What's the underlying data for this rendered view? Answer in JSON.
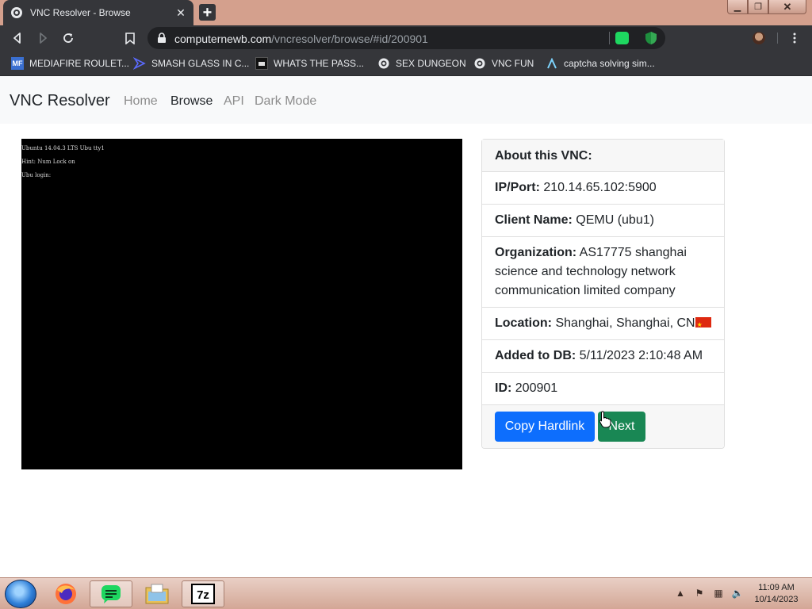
{
  "browser": {
    "tab_title": "VNC Resolver - Browse",
    "tab_close": "✕",
    "url_host": "computernewb.com",
    "url_path": "/vncresolver/browse/#id/200901"
  },
  "bookmarks": [
    {
      "icon_text": "MF",
      "label": "MEDIAFIRE ROULET..."
    },
    {
      "icon_text": "",
      "label": "SMASH GLASS IN C..."
    },
    {
      "icon_text": "",
      "label": "WHATS THE PASS..."
    },
    {
      "icon_text": "",
      "label": "SEX DUNGEON"
    },
    {
      "icon_text": "",
      "label": "VNC FUN"
    },
    {
      "icon_text": "",
      "label": "captcha solving sim..."
    }
  ],
  "navbar": {
    "brand": "VNC Resolver",
    "links": [
      "Home",
      "Browse",
      "API",
      "Dark Mode"
    ],
    "active": "Browse"
  },
  "vnc_screen": {
    "lines": [
      "Ubuntu 14.04.3 LTS Ubu tty1",
      "Hint: Num Lock on",
      "Ubu login:"
    ]
  },
  "details": {
    "header": "About this VNC:",
    "ip_label": "IP/Port:",
    "ip_value": "210.14.65.102:5900",
    "client_label": "Client Name:",
    "client_value": "QEMU (ubu1)",
    "org_label": "Organization:",
    "org_value": "AS17775 shanghai science and technology network communication limited company",
    "loc_label": "Location:",
    "loc_value": "Shanghai, Shanghai, CN",
    "added_label": "Added to DB:",
    "added_value": "5/11/2023 2:10:48 AM",
    "id_label": "ID:",
    "id_value": "200901",
    "copy_button": "Copy Hardlink",
    "next_button": "Next"
  },
  "taskbar": {
    "time": "11:09 AM",
    "date": "10/14/2023"
  }
}
